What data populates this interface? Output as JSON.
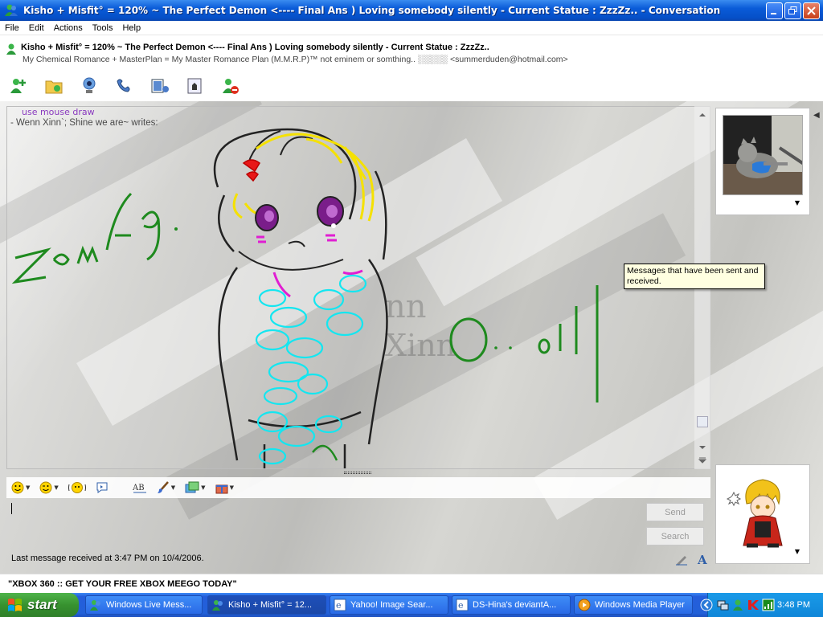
{
  "window": {
    "title": "Kisho + Misfit° = 120% ~ The Perfect Demon <---- Final Ans ) Loving somebody silently -  Current Statue : ZzzZz.. - Conversation"
  },
  "menu": [
    "File",
    "Edit",
    "Actions",
    "Tools",
    "Help"
  ],
  "contact": {
    "name": "Kisho + Misfit° = 120% ~ The Perfect Demon <---- Final Ans ) Loving somebody silently -  Current Statue : ZzzZz..",
    "psm": "My Chemical Romance + MasterPlan = My Master Romance Plan (M.M.R.P)™ not eminem or somthing.. ░░░░░ <summerduden@hotmail.com>"
  },
  "toolbar_icons": [
    "invite-icon",
    "send-files-icon",
    "webcam-icon",
    "call-icon",
    "activities-icon",
    "games-icon",
    "block-icon"
  ],
  "history": {
    "partial_line": "use mouse draw",
    "sender_line": "- Wenn Xinn`;  Shine we are~ writes:"
  },
  "tooltip": "Messages that have been sent and received.",
  "input_toolbar_icons": [
    "emoticon-icon",
    "wink-icon",
    "nudge-icon",
    "voice-clip-icon",
    "font-icon",
    "background-icon",
    "ink-icon",
    "gift-icon"
  ],
  "buttons": {
    "send": "Send",
    "search": "Search"
  },
  "status_line": "Last message received at 3:47 PM on 10/4/2006.",
  "ad_banner": "\"XBOX 360 :: GET YOUR FREE XBOX MEEGO TODAY\"",
  "taskbar": {
    "start": "start",
    "tasks": [
      {
        "label": "Windows Live Mess..."
      },
      {
        "label": "Kisho + Misfit° = 12..."
      },
      {
        "label": "Yahoo! Image Sear..."
      },
      {
        "label": "DS-Hina's deviantA..."
      },
      {
        "label": "Windows Media Player"
      }
    ],
    "clock": "3:48 PM"
  },
  "colors": {
    "titlebar": "#0a5bd8",
    "ink_green": "#1e8a1e",
    "ink_yellow": "#f5e100",
    "ink_cyan": "#14e6f0",
    "ink_magenta": "#e01ed2"
  }
}
